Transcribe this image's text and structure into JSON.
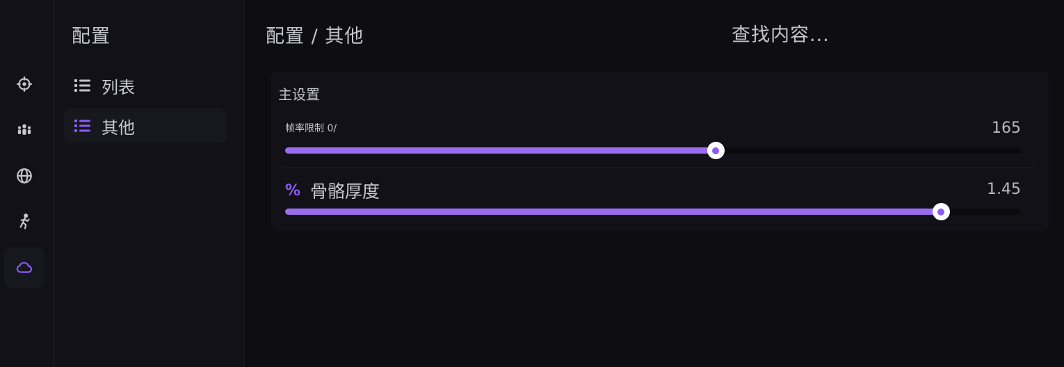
{
  "rail": {
    "items": [
      {
        "icon": "crosshair-icon"
      },
      {
        "icon": "users-icon"
      },
      {
        "icon": "globe-icon"
      },
      {
        "icon": "running-person-icon"
      },
      {
        "icon": "cloud-icon",
        "active": true
      }
    ]
  },
  "sidebar": {
    "title": "配置",
    "items": [
      {
        "label": "列表",
        "icon": "list-icon"
      },
      {
        "label": "其他",
        "icon": "list-icon",
        "active": true
      }
    ]
  },
  "header": {
    "breadcrumb": "配置 / 其他",
    "search_placeholder": "查找内容..."
  },
  "card": {
    "title": "主设置",
    "sliders": [
      {
        "label": "帧率限制 0/",
        "value_text": "165",
        "fraction": 0.585
      },
      {
        "label": "骨骼厚度",
        "icon": "percent-icon",
        "value_text": "1.45",
        "fraction": 0.891
      }
    ]
  },
  "colors": {
    "accent": "#8b5cf6",
    "fill": "#9b6cf0",
    "background": "#0d0d12",
    "panel": "#111117"
  }
}
